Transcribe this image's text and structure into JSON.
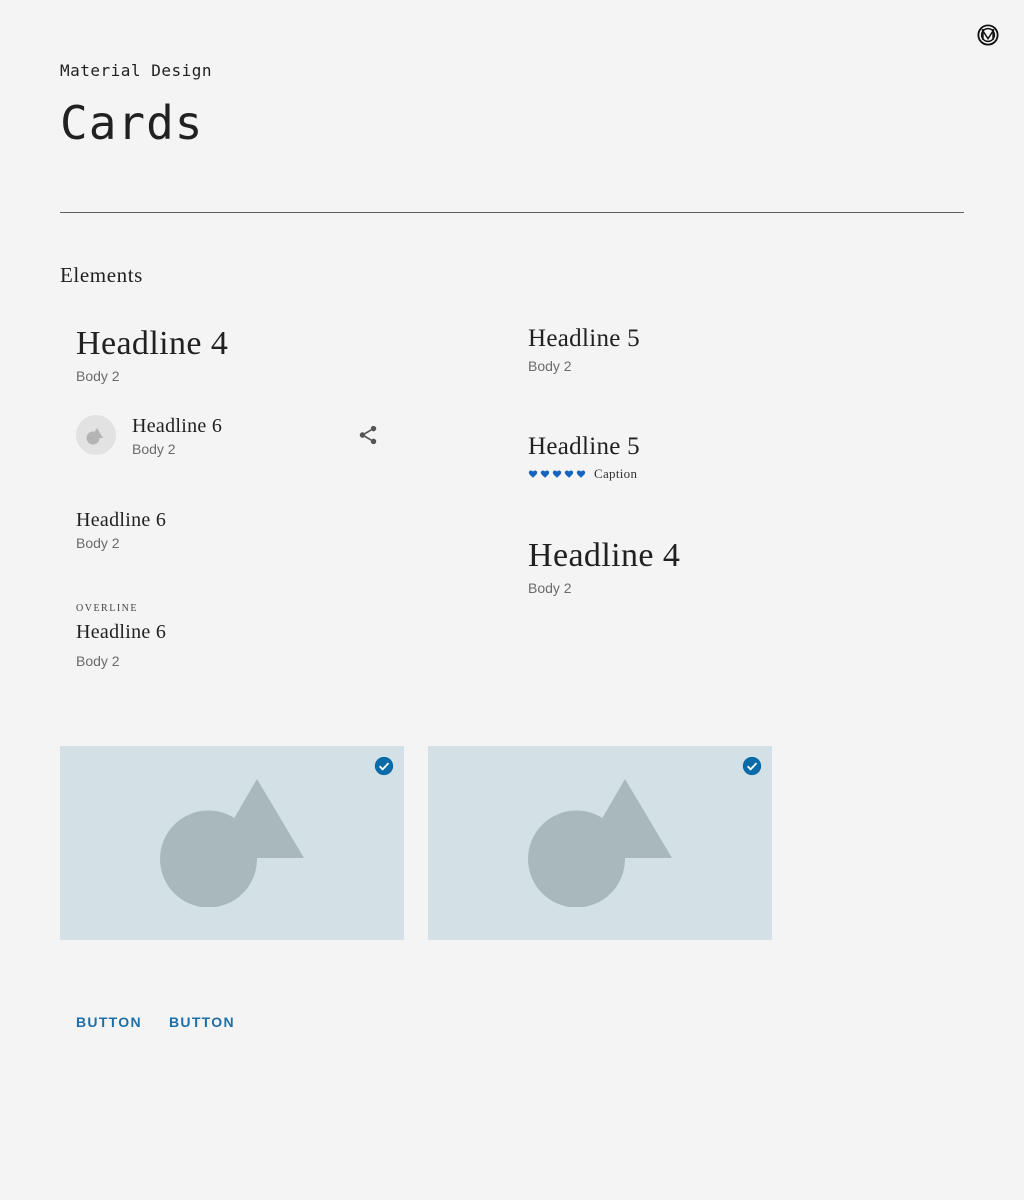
{
  "header": {
    "brand": "Material Design",
    "title": "Cards"
  },
  "section": {
    "title": "Elements"
  },
  "elements": {
    "left": {
      "h4_block": {
        "headline": "Headline 4",
        "body": "Body 2"
      },
      "list_block": {
        "headline": "Headline 6",
        "body": "Body 2",
        "avatar_icon": "shapes-icon",
        "action_icon": "share-icon"
      },
      "h6_block": {
        "headline": "Headline 6",
        "body": "Body 2"
      },
      "overline_block": {
        "overline": "OVERLINE",
        "headline": "Headline 6",
        "body": "Body 2"
      }
    },
    "right": {
      "h5_block": {
        "headline": "Headline 5",
        "body": "Body 2"
      },
      "rating_block": {
        "headline": "Headline 5",
        "rating": 5,
        "rating_max": 5,
        "rating_icon": "heart-icon",
        "caption": "Caption"
      },
      "h4_block": {
        "headline": "Headline 4",
        "body": "Body 2"
      }
    }
  },
  "media_cards": [
    {
      "icon": "shapes-placeholder-icon",
      "selected": true,
      "selected_icon": "check-circle-icon"
    },
    {
      "icon": "shapes-placeholder-icon",
      "selected": true,
      "selected_icon": "check-circle-icon"
    }
  ],
  "actions": {
    "button1": "BUTTON",
    "button2": "BUTTON"
  },
  "colors": {
    "background": "#f4f4f4",
    "accent": "#1e6fa6",
    "media_bg": "#d3e1e6",
    "media_shape": "#a9b8bc",
    "rating": "#1565c0"
  }
}
